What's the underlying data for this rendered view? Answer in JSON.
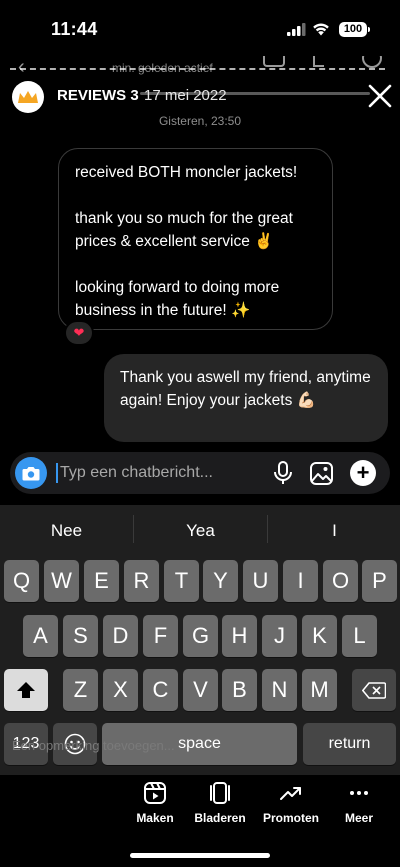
{
  "status_bar": {
    "time": "11:44",
    "battery": "100"
  },
  "background_app": {
    "hint": "min. geleden actief"
  },
  "story": {
    "username": "REVIEWS 3",
    "date": "17 mei 2022"
  },
  "chat": {
    "timestamp": "Gisteren, 23:50",
    "incoming": {
      "line1": "received BOTH moncler jackets!",
      "line2": "thank you so much for the great prices & excellent service ✌️",
      "line3": "looking forward to doing more business in the future! ✨",
      "reaction": "❤"
    },
    "outgoing": {
      "text": "Thank you aswell my friend, anytime again! Enjoy your jackets 💪🏻"
    }
  },
  "composer": {
    "placeholder": "Typ een chatbericht..."
  },
  "keyboard": {
    "suggestions": [
      "Nee",
      "Yea",
      "I"
    ],
    "row1": [
      "Q",
      "W",
      "E",
      "R",
      "T",
      "Y",
      "U",
      "I",
      "O",
      "P"
    ],
    "row2": [
      "A",
      "S",
      "D",
      "F",
      "G",
      "H",
      "J",
      "K",
      "L"
    ],
    "row3": [
      "Z",
      "X",
      "C",
      "V",
      "B",
      "N",
      "M"
    ],
    "numbers_key": "123",
    "space_key": "space",
    "return_key": "return"
  },
  "hidden_hint": "Een opmerking toevoegen...",
  "bottom_tools": [
    {
      "label": "Maken",
      "icon": "clip-icon"
    },
    {
      "label": "Bladeren",
      "icon": "stack-icon"
    },
    {
      "label": "Promoten",
      "icon": "trend-icon"
    },
    {
      "label": "Meer",
      "icon": "more-icon"
    }
  ],
  "colors": {
    "accent": "#3797f0",
    "bubble_out": "#262626",
    "keyboard_bg": "#1f1f1f",
    "reaction": "#ff2d55"
  }
}
